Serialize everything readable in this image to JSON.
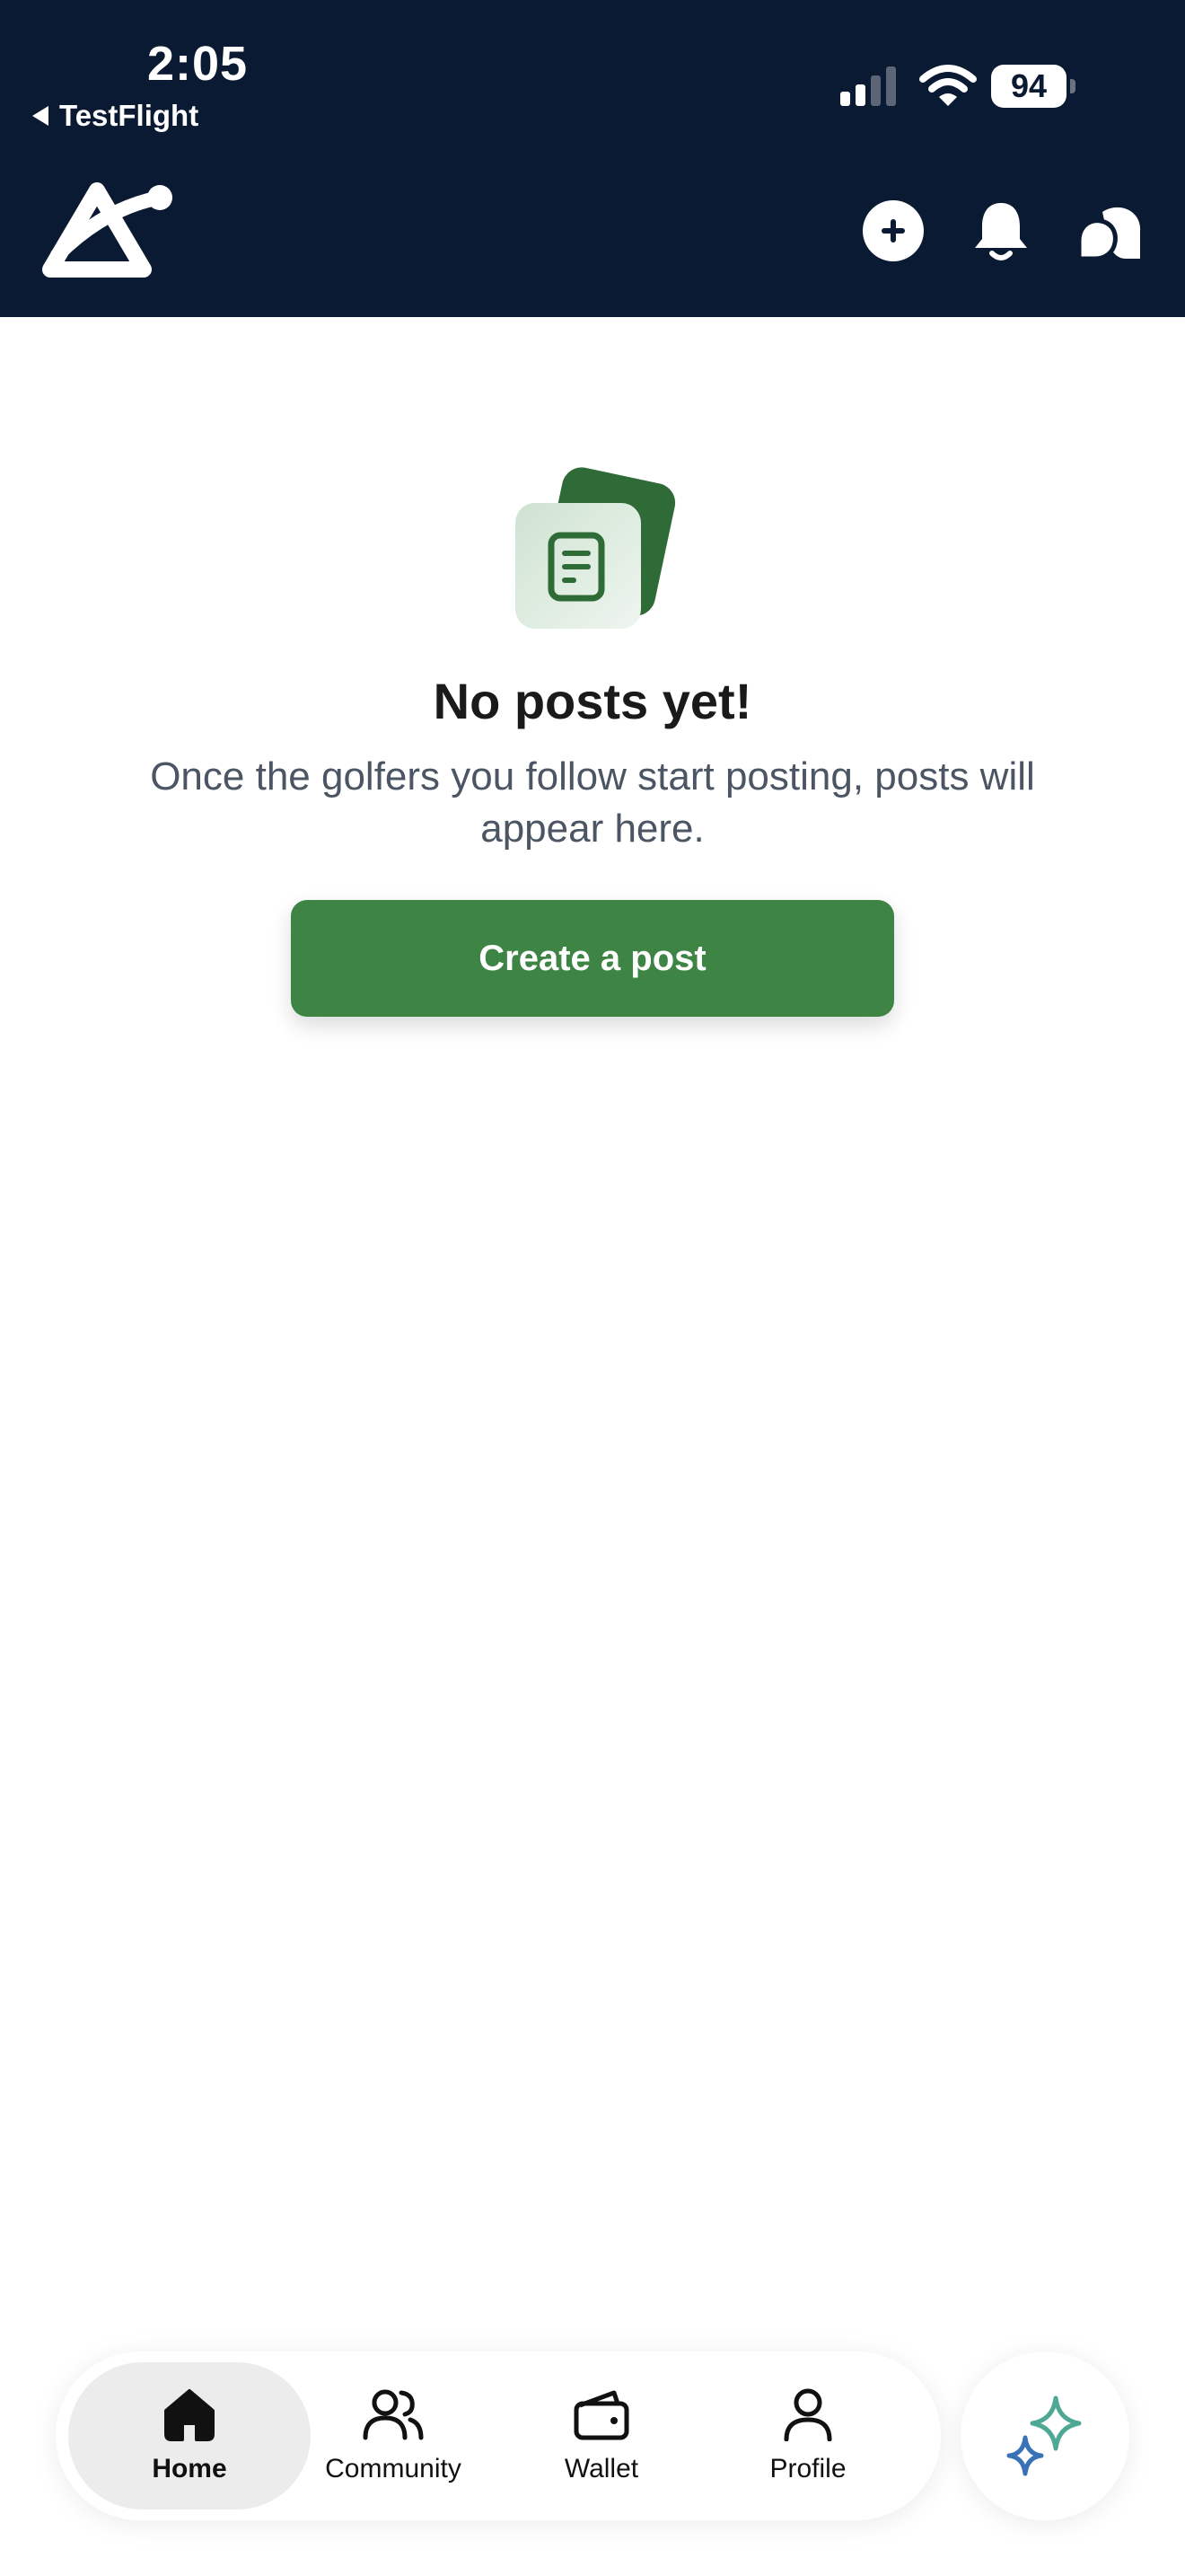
{
  "status_bar": {
    "time": "2:05",
    "back_app": "TestFlight",
    "battery": "94"
  },
  "header": {
    "icons": [
      "app-logo-icon",
      "plus-circle-icon",
      "bell-icon",
      "chat-bubbles-icon"
    ]
  },
  "empty_state": {
    "icon": "document-cards-icon",
    "title": "No posts yet!",
    "description": "Once the golfers you follow start posting, posts will appear here.",
    "button_label": "Create a post"
  },
  "tabbar": {
    "items": [
      {
        "label": "Home",
        "icon": "home-icon",
        "active": true
      },
      {
        "label": "Community",
        "icon": "people-icon",
        "active": false
      },
      {
        "label": "Wallet",
        "icon": "wallet-icon",
        "active": false
      },
      {
        "label": "Profile",
        "icon": "person-icon",
        "active": false
      }
    ],
    "ai_button_icon": "sparkle-icon"
  },
  "colors": {
    "header_bg": "#0b1a33",
    "primary_green": "#3d8445",
    "dark_green": "#2e6b36",
    "text_dark": "#1a1a1a",
    "text_muted": "#4b5563"
  }
}
